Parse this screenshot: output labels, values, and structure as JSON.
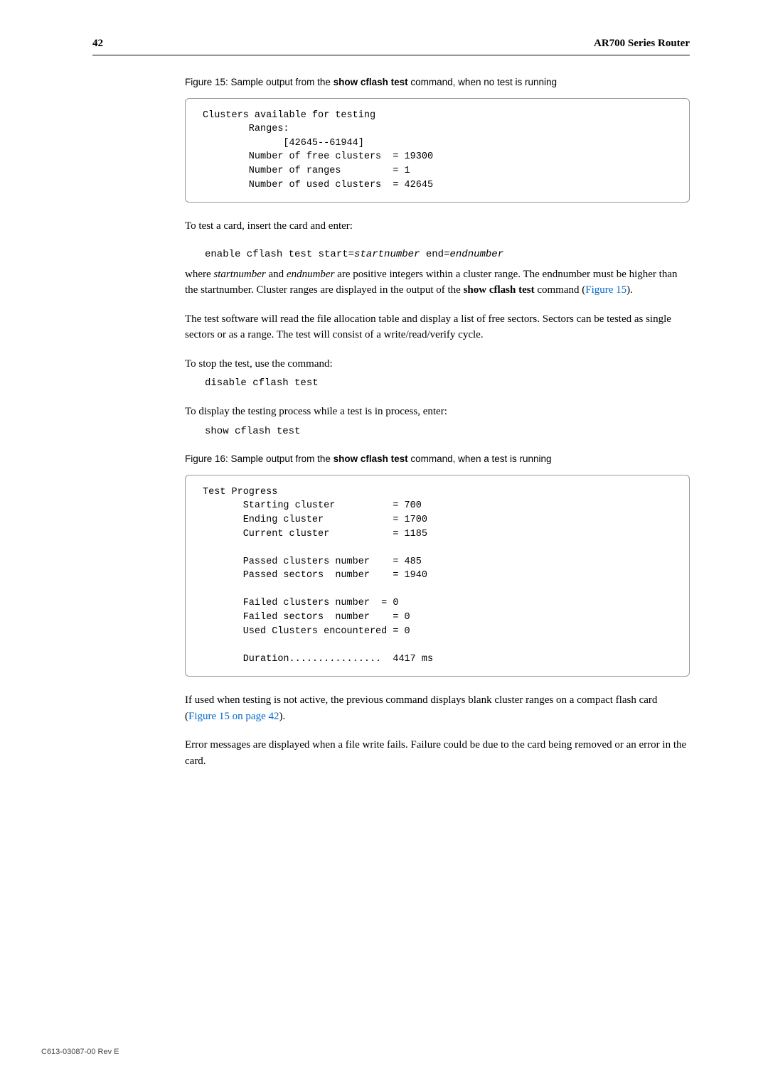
{
  "header": {
    "page_number": "42",
    "title": "AR700 Series Router"
  },
  "fig15": {
    "caption_pre": "Figure 15: Sample output from the ",
    "caption_cmd": "show cflash test",
    "caption_post": " command, when no test is running",
    "code": "Clusters available for testing\n        Ranges:\n              [42645--61944]\n        Number of free clusters  = 19300\n        Number of ranges         = 1\n        Number of used clusters  = 42645"
  },
  "p1": "To test a card, insert the card and enter:",
  "cmd1_pre": "enable cflash test start=",
  "cmd1_i1": "startnumber",
  "cmd1_mid": " end=",
  "cmd1_i2": "endnumber",
  "p2_a": "where ",
  "p2_i1": "startnumber",
  "p2_b": " and ",
  "p2_i2": "endnumber",
  "p2_c": " are positive integers within a cluster range. The endnumber must be higher than the startnumber. Cluster ranges are displayed in the output of the ",
  "p2_bold": "show cflash test",
  "p2_d": " command (",
  "p2_link": "Figure 15",
  "p2_e": ").",
  "p3": "The test software will read the file allocation table and display a list of free sectors. Sectors can be tested as single sectors or as a range. The test will consist of a write/read/verify cycle.",
  "p4": "To stop the test, use the command:",
  "cmd2": "disable cflash test",
  "p5": "To display the testing process while a test is in process, enter:",
  "cmd3": "show cflash test",
  "fig16": {
    "caption_pre": "Figure 16: Sample output from the ",
    "caption_cmd": "show cflash test",
    "caption_post": " command, when a test is running",
    "code": "Test Progress\n       Starting cluster          = 700\n       Ending cluster            = 1700\n       Current cluster           = 1185\n\n       Passed clusters number    = 485\n       Passed sectors  number    = 1940\n\n       Failed clusters number  = 0\n       Failed sectors  number    = 0\n       Used Clusters encountered = 0\n\n       Duration................  4417 ms"
  },
  "p6_a": "If used when testing is not active, the previous command displays blank cluster ranges on a compact flash card (",
  "p6_link": "Figure 15 on page 42",
  "p6_b": ").",
  "p7": "Error messages are displayed when a file write fails. Failure could be due to the card being removed or an error in the card.",
  "footer": "C613-03087-00 Rev E"
}
